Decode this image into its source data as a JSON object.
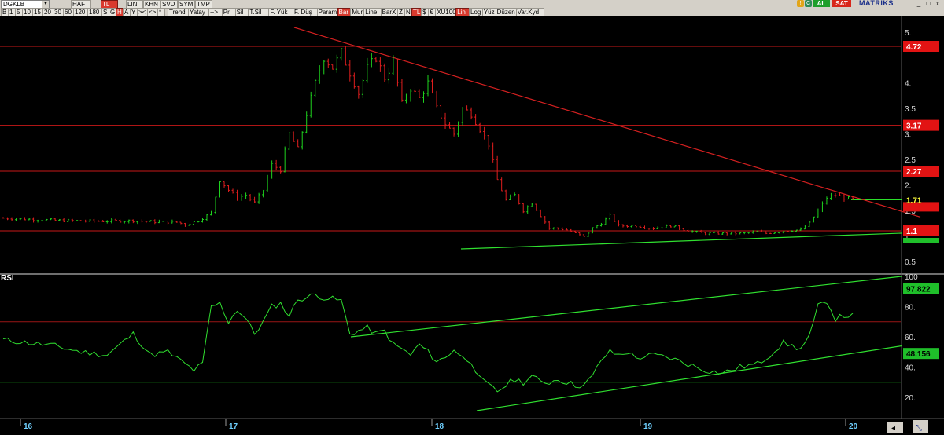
{
  "toolbar": {
    "symbol": "DGKLB",
    "period_buttons": [
      "HAF",
      "TL",
      "LIN",
      "KHN",
      "SVD",
      "SYM",
      "TMP",
      "B",
      "1",
      "5",
      "10",
      "15",
      "20",
      "30",
      "60",
      "120",
      "180",
      "S",
      "G",
      "H",
      "A",
      "Y",
      "><",
      "<>",
      "*"
    ],
    "tool_buttons": [
      "Trend",
      "Yatay",
      "-->",
      "Prl",
      "Sil",
      "T.Sil",
      "F. Yük",
      "F. Düş",
      "Param",
      "Bar",
      "Mum",
      "Line",
      "BarX",
      "Z",
      "N",
      "TL",
      "$",
      "€",
      "XU100",
      "Lin",
      "Log",
      "Yüz",
      "Düzen",
      "Var.Kyd"
    ],
    "active_red": [
      "H",
      "Bar",
      "TL",
      "Lin"
    ],
    "buy_label": "AL",
    "sell_label": "SAT",
    "brand": "MATRİKS"
  },
  "price_panel": {
    "axis_ticks": [
      "5.",
      "4.",
      "3.5",
      "3.",
      "2.5",
      "2.",
      "1.5",
      "1.",
      "0.5"
    ],
    "axis_tick_values": [
      5,
      4,
      3.5,
      3,
      2.5,
      2,
      1.5,
      1,
      0.5
    ],
    "hlines": [
      {
        "value": 4.72,
        "label": "4.72"
      },
      {
        "value": 3.17,
        "label": "3.17"
      },
      {
        "value": 2.27,
        "label": "2.27"
      },
      {
        "value": 1.1,
        "label": "1.1"
      }
    ],
    "last_price": {
      "value": 1.71,
      "label": "1.71"
    }
  },
  "rsi_panel": {
    "title": "RSI",
    "axis_ticks": [
      "100",
      "80.",
      "60.",
      "40.",
      "20."
    ],
    "axis_tick_values": [
      100,
      80,
      60,
      40,
      20
    ],
    "current_value": "97.822",
    "current_value_num": 97.822,
    "second_value": "48.156",
    "second_value_num": 48.156,
    "overbought": 70,
    "oversold": 30
  },
  "x_axis": {
    "labels": [
      "16",
      "17",
      "18",
      "19",
      "20"
    ]
  },
  "chart_data": {
    "type": "bar",
    "symbol": "DGKLB",
    "x_labels": [
      "16",
      "17",
      "18",
      "19",
      "20"
    ],
    "ylim": [
      0.3,
      5.3
    ],
    "price_path": [
      [
        0,
        1.35
      ],
      [
        8,
        1.32
      ],
      [
        14,
        1.3
      ],
      [
        22,
        1.29
      ],
      [
        30,
        1.3
      ],
      [
        34,
        1.28
      ],
      [
        40,
        1.27
      ],
      [
        42,
        1.22
      ],
      [
        45,
        1.3
      ],
      [
        48,
        1.45
      ],
      [
        50,
        2.1
      ],
      [
        52,
        1.9
      ],
      [
        54,
        1.75
      ],
      [
        56,
        1.8
      ],
      [
        58,
        1.65
      ],
      [
        60,
        1.9
      ],
      [
        62,
        2.4
      ],
      [
        64,
        2.3
      ],
      [
        66,
        3.0
      ],
      [
        68,
        2.7
      ],
      [
        70,
        3.4
      ],
      [
        72,
        4.0
      ],
      [
        74,
        4.5
      ],
      [
        76,
        4.3
      ],
      [
        78,
        4.6
      ],
      [
        80,
        4.2
      ],
      [
        82,
        3.8
      ],
      [
        84,
        4.3
      ],
      [
        86,
        4.5
      ],
      [
        88,
        4.1
      ],
      [
        90,
        4.4
      ],
      [
        92,
        3.6
      ],
      [
        94,
        3.9
      ],
      [
        96,
        3.7
      ],
      [
        98,
        4.0
      ],
      [
        100,
        3.5
      ],
      [
        102,
        3.2
      ],
      [
        104,
        3.0
      ],
      [
        106,
        3.5
      ],
      [
        108,
        3.4
      ],
      [
        110,
        3.1
      ],
      [
        112,
        2.8
      ],
      [
        114,
        2.1
      ],
      [
        116,
        1.7
      ],
      [
        118,
        1.8
      ],
      [
        120,
        1.5
      ],
      [
        122,
        1.65
      ],
      [
        124,
        1.4
      ],
      [
        126,
        1.15
      ],
      [
        128,
        1.15
      ],
      [
        130,
        1.12
      ],
      [
        132,
        1.05
      ],
      [
        134,
        0.98
      ],
      [
        136,
        1.15
      ],
      [
        138,
        1.25
      ],
      [
        140,
        1.4
      ],
      [
        142,
        1.2
      ],
      [
        144,
        1.2
      ],
      [
        146,
        1.2
      ],
      [
        150,
        1.15
      ],
      [
        154,
        1.2
      ],
      [
        158,
        1.1
      ],
      [
        162,
        1.05
      ],
      [
        166,
        1.05
      ],
      [
        170,
        1.05
      ],
      [
        174,
        1.08
      ],
      [
        176,
        1.05
      ],
      [
        180,
        1.1
      ],
      [
        184,
        1.12
      ],
      [
        186,
        1.25
      ],
      [
        188,
        1.5
      ],
      [
        190,
        1.75
      ],
      [
        192,
        1.8
      ],
      [
        194,
        1.75
      ],
      [
        196,
        1.72
      ]
    ],
    "rsi_path": [
      [
        0,
        58
      ],
      [
        6,
        56
      ],
      [
        12,
        54
      ],
      [
        18,
        50
      ],
      [
        24,
        48
      ],
      [
        30,
        62
      ],
      [
        34,
        48
      ],
      [
        38,
        50
      ],
      [
        42,
        42
      ],
      [
        44,
        38
      ],
      [
        46,
        42
      ],
      [
        48,
        80
      ],
      [
        50,
        82
      ],
      [
        52,
        70
      ],
      [
        54,
        78
      ],
      [
        56,
        72
      ],
      [
        58,
        62
      ],
      [
        60,
        70
      ],
      [
        62,
        80
      ],
      [
        64,
        82
      ],
      [
        66,
        74
      ],
      [
        68,
        85
      ],
      [
        70,
        86
      ],
      [
        72,
        88
      ],
      [
        74,
        86
      ],
      [
        76,
        85
      ],
      [
        78,
        84
      ],
      [
        80,
        62
      ],
      [
        82,
        64
      ],
      [
        84,
        66
      ],
      [
        86,
        62
      ],
      [
        88,
        64
      ],
      [
        90,
        55
      ],
      [
        92,
        52
      ],
      [
        94,
        48
      ],
      [
        96,
        55
      ],
      [
        98,
        50
      ],
      [
        100,
        44
      ],
      [
        102,
        46
      ],
      [
        104,
        52
      ],
      [
        106,
        46
      ],
      [
        108,
        44
      ],
      [
        110,
        32
      ],
      [
        112,
        28
      ],
      [
        114,
        24
      ],
      [
        116,
        28
      ],
      [
        118,
        32
      ],
      [
        120,
        30
      ],
      [
        122,
        34
      ],
      [
        124,
        30
      ],
      [
        126,
        30
      ],
      [
        128,
        32
      ],
      [
        130,
        30
      ],
      [
        132,
        28
      ],
      [
        134,
        28
      ],
      [
        136,
        34
      ],
      [
        138,
        45
      ],
      [
        140,
        50
      ],
      [
        142,
        48
      ],
      [
        144,
        50
      ],
      [
        146,
        46
      ],
      [
        150,
        48
      ],
      [
        154,
        46
      ],
      [
        158,
        42
      ],
      [
        162,
        38
      ],
      [
        166,
        36
      ],
      [
        170,
        40
      ],
      [
        174,
        42
      ],
      [
        176,
        46
      ],
      [
        180,
        56
      ],
      [
        184,
        52
      ],
      [
        186,
        60
      ],
      [
        188,
        80
      ],
      [
        190,
        84
      ],
      [
        192,
        72
      ],
      [
        194,
        74
      ],
      [
        196,
        74
      ]
    ]
  }
}
